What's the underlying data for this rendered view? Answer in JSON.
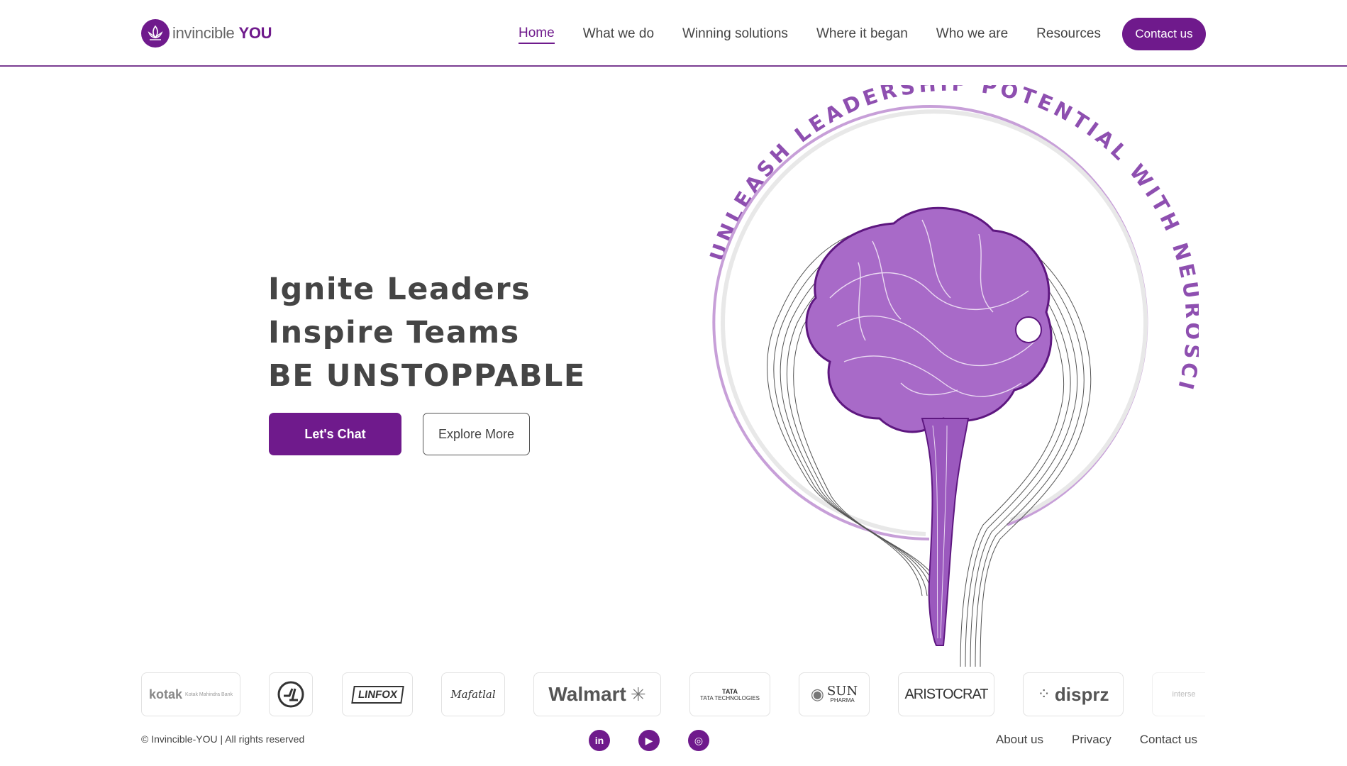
{
  "brand": {
    "name_prefix": "invincible",
    "name_suffix": "YOU",
    "accent_color": "#6f1a8c"
  },
  "nav": {
    "items": [
      {
        "label": "Home",
        "active": true
      },
      {
        "label": "What we do"
      },
      {
        "label": "Winning solutions"
      },
      {
        "label": "Where it began"
      },
      {
        "label": "Who we are"
      },
      {
        "label": "Resources"
      }
    ],
    "contact_label": "Contact us"
  },
  "hero": {
    "lines": [
      "Ignite Leaders",
      "Inspire Teams",
      "BE UNSTOPPABLE"
    ],
    "primary_cta": "Let's Chat",
    "secondary_cta": "Explore More",
    "arc_text": "UNLEASH LEADERSHIP POTENTIAL WITH NEUROSCIENCE"
  },
  "clients": [
    {
      "name": "kotak",
      "sub": "Kotak Mahindra Bank",
      "icon": "kotak-logo"
    },
    {
      "name": "",
      "icon": "l-and-t-logo"
    },
    {
      "name": "LINFOX",
      "icon": "linfox-logo"
    },
    {
      "name": "Mafatlal",
      "icon": "mafatlal-logo"
    },
    {
      "name": "Walmart",
      "icon": "walmart-logo"
    },
    {
      "name": "TATA",
      "sub": "TATA TECHNOLOGIES",
      "icon": "tata-technologies-logo"
    },
    {
      "name": "SUN",
      "sub": "PHARMA",
      "icon": "sun-pharma-logo"
    },
    {
      "name": "ARISTOCRAT",
      "icon": "aristocrat-logo"
    },
    {
      "name": "disprz",
      "icon": "disprz-logo"
    },
    {
      "name": "interse",
      "icon": "interse-logo"
    }
  ],
  "footer": {
    "copyright": "© Invincible-YOU | All rights reserved",
    "socials": [
      {
        "icon": "linkedin-icon",
        "glyph": "in"
      },
      {
        "icon": "youtube-icon",
        "glyph": "▶"
      },
      {
        "icon": "instagram-icon",
        "glyph": "◎"
      }
    ],
    "links": [
      "About us",
      "Privacy",
      "Contact us"
    ]
  }
}
